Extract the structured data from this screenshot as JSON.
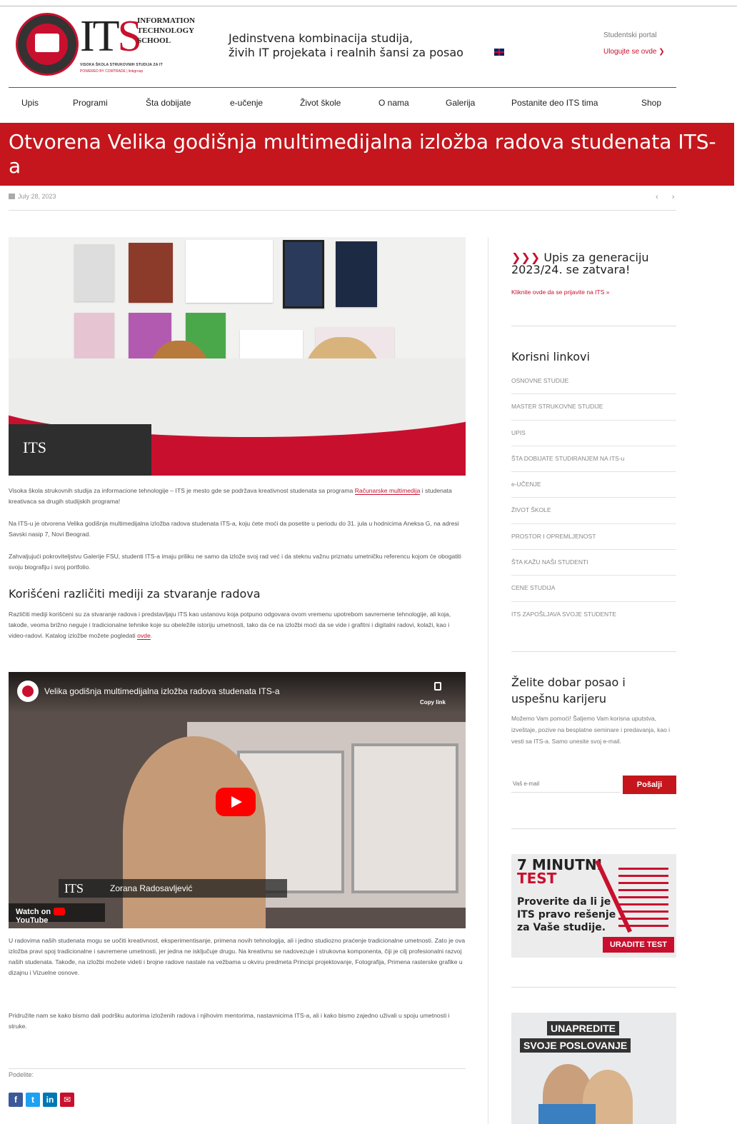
{
  "header": {
    "logo_its": "IT",
    "logo_its_s": "S",
    "logo_right": "INFORMATION TECHNOLOGY SCHOOL",
    "logo_sub1": "VISOKA ŠKOLA STRUKOVNIH STUDIJA ZA IT",
    "logo_sub2": "POWERED BY COMTRADE | linkgroup",
    "tagline_line1": "Jedinstvena kombinacija studija,",
    "tagline_line2": "živih IT projekata i realnih šansi za posao",
    "portal_title": "Studentski portal",
    "portal_link": "Ulogujte se ovde ❯"
  },
  "nav": [
    "Upis",
    "Programi",
    "Šta dobijate",
    "e-učenje",
    "Život škole",
    "O nama",
    "Galerija",
    "Postanite deo ITS tima",
    "Shop"
  ],
  "article": {
    "title": "Otvorena Velika godišnja multimedijalna izložba radova studenata ITS-a",
    "date": "July 28, 2023",
    "pager": "‹ ›",
    "p1_a": "Visoka škola strukovnih studija za informacione tehnologije – ITS je mesto gde se podržava kreativnost studenata sa programa ",
    "p1_link": "Računarske multimedija",
    "p1_b": " i studenata kreativaca sa drugih studijskih programa!",
    "p2": "Na ITS-u je otvorena Velika godišnja multimedijalna izložba radova studenata ITS-a, koju ćete moći da posetite u periodu do 31. jula u hodnicima Aneksa G, na adresi Savski nasip 7, Novi Beograd.",
    "p3": "Zahvaljujući pokroviteljstvu Galerije FSU, studenti ITS-a imaju priliku ne samo da izlože svoj rad već i da steknu važnu priznatu umetničku referencu kojom će obogatiti svoju biografiju i svoj portfolio.",
    "h2": "Korišćeni različiti mediji za stvaranje radova",
    "p4_a": "Različiti mediji korišćeni su za stvaranje radova i predstavljaju ITS kao ustanovu koja potpuno odgovara ovom vremenu upotrebom savremene tehnologije, ali koja, takođe, veoma brižno neguje i tradicionalne tehnike koje su obeležile istoriju umetnosti, tako da će na izložbi moći da se vide i grafitni i digitalni radovi, kolaži, kao i video-radovi. Katalog izložbe možete pogledati ",
    "p4_link": "ovde",
    "p4_b": ".",
    "p5": "U radovima naših studenata mogu se uočiti kreativnost, eksperimentisanje, primena novih tehnologija, ali i jedno studiozno praćenje tradicionalne umetnosti. Zato je ova izložba pravi spoj tradicionalne i savremene umetnosti, jer jedna ne isključuje drugu. Na kreativnu se nadovezuje i strukovna komponenta, čiji je cilj profesionalni razvoj naših studenata. Takođe, na izložbi možete videti i brojne radove nastale na vežbama u okviru predmeta Principi projektovanje, Fotografija, Primena rasterske grafike u dizajnu i Vizuelne osnove.",
    "p6": "Pridružite nam se kako bismo dali podršku autorima izloženih radova i njihovim mentorima, nastavnicima ITS-a, ali i kako bismo zajedno uživali u spoju umetnosti i struke.",
    "feat_logo": "ITS",
    "share_label": "Podelite:"
  },
  "video": {
    "title": "Velika godišnja multimedijalna izložba radova studenata ITS-a",
    "copy_link": "Copy link",
    "lower_its": "ITS",
    "lower_name": "Zorana Radosavljević",
    "watch_on": "Watch on",
    "youtube": "YouTube"
  },
  "social": [
    "f",
    "t",
    "in",
    "✉"
  ],
  "social_colors": [
    "#3b5998",
    "#1da1f2",
    "#0077b5",
    "#c8102e"
  ],
  "sidebar": {
    "upis_arrows": "❯❯❯",
    "upis_title": "Upis za generaciju 2023/24. se zatvara!",
    "upis_link": "Kliknite ovde da se prijavite na ITS »",
    "links_title": "Korisni linkovi",
    "links": [
      "OSNOVNE STUDIJE",
      "MASTER STRUKOVNE STUDIJE",
      "UPIS",
      "ŠTA DOBIJATE STUDIRANJEM NA ITS-u",
      "e-UČENJE",
      "ŽIVOT ŠKOLE",
      "PROSTOR I OPREMLJENOST",
      "ŠTA KAŽU NAŠI STUDENTI",
      "CENE STUDIJA",
      "ITS ZAPOŠLJAVA SVOJE STUDENTE"
    ],
    "job_title": "Želite dobar posao i uspešnu karijeru",
    "job_text": "Možemo Vam pomoći! Šaljemo Vam korisna uputstva, izveštaje, pozive na besplatne seminare i predavanja, kao i vesti sa ITS-a. Samo unesite svoj e-mail.",
    "email_placeholder": "Vaš e-mail",
    "send_label": "Pošalji",
    "test_line1": "7 MINUTNI",
    "test_line2": "TEST",
    "test_body": "Proverite da li je ITS pravo rešenje za Vaše studije.",
    "test_button": "URADITE TEST",
    "ad_line1": "UNAPREDITE",
    "ad_line2": "SVOJE POSLOVANJE"
  },
  "colors": {
    "brand_red": "#c4161c",
    "text": "#333333",
    "muted": "#777777"
  }
}
